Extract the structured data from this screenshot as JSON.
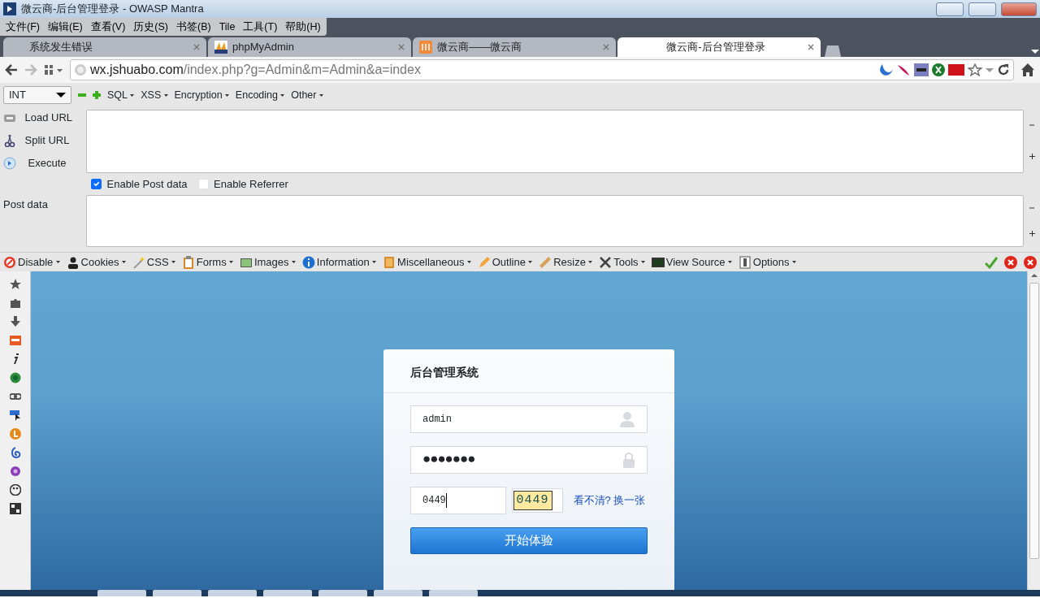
{
  "window": {
    "title": "微云商-后台管理登录 - OWASP Mantra"
  },
  "menu": [
    "文件(F)",
    "编辑(E)",
    "查看(V)",
    "历史(S)",
    "书签(B)",
    "Tile",
    "工具(T)",
    "帮助(H)"
  ],
  "tabs": [
    {
      "label": "系统发生错误",
      "selected": false,
      "kind": "plain"
    },
    {
      "label": "phpMyAdmin",
      "selected": false,
      "kind": "pma"
    },
    {
      "label": "微云商——微云商",
      "selected": false,
      "kind": "wei"
    },
    {
      "label": "微云商-后台管理登录",
      "selected": true,
      "kind": "plain"
    }
  ],
  "address": {
    "host": "wx.jshuabo.com",
    "path": "/index.php?g=Admin&m=Admin&a=index"
  },
  "hackbar": {
    "type": "INT",
    "menus": [
      "SQL",
      "XSS",
      "Encryption",
      "Encoding",
      "Other"
    ],
    "actions": [
      "Load URL",
      "Split URL",
      "Execute"
    ],
    "options": [
      {
        "label": "Enable Post data",
        "checked": true
      },
      {
        "label": "Enable Referrer",
        "checked": false
      }
    ],
    "post_label": "Post data"
  },
  "devtools": [
    "Disable",
    "Cookies",
    "CSS",
    "Forms",
    "Images",
    "Information",
    "Miscellaneous",
    "Outline",
    "Resize",
    "Tools",
    "View Source",
    "Options"
  ],
  "login": {
    "title": "后台管理系统",
    "username": "admin",
    "password": "●●●●●●●",
    "captcha_input": "0449",
    "captcha": "0449",
    "refresh_link": "看不清? 换一张",
    "submit": "开始体验"
  }
}
